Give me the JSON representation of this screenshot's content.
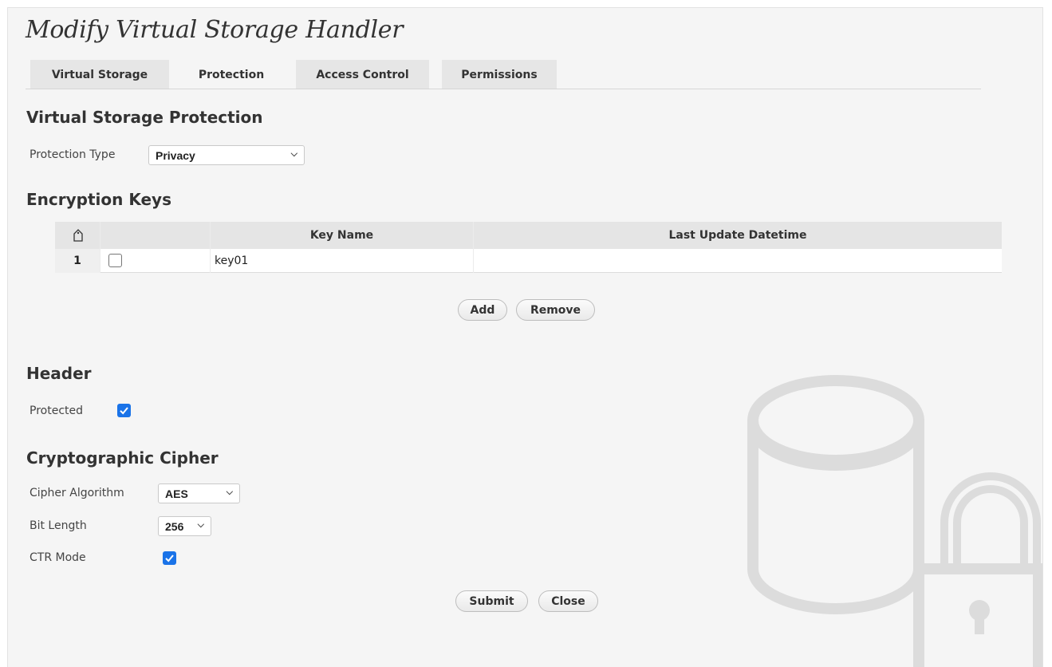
{
  "page": {
    "title": "Modify Virtual Storage Handler"
  },
  "tabs": [
    {
      "label": "Virtual Storage"
    },
    {
      "label": "Protection",
      "active": true
    },
    {
      "label": "Access Control"
    },
    {
      "label": "Permissions"
    }
  ],
  "protection": {
    "title": "Virtual Storage Protection",
    "type_label": "Protection Type",
    "type_value": "Privacy"
  },
  "keys": {
    "title": "Encryption Keys",
    "header_icon": "sort-tag-icon",
    "columns": [
      "Key Name",
      "Last Update Datetime"
    ],
    "rows": [
      {
        "num": "1",
        "checked": false,
        "key_name": "key01",
        "updated": ""
      }
    ],
    "add_label": "Add",
    "remove_label": "Remove"
  },
  "header": {
    "title": "Header",
    "protected_label": "Protected",
    "protected_checked": true
  },
  "cipher": {
    "title": "Cryptographic Cipher",
    "algorithm_label": "Cipher Algorithm",
    "algorithm_value": "AES",
    "bitlength_label": "Bit Length",
    "bitlength_value": "256",
    "ctr_label": "CTR Mode",
    "ctr_checked": true
  },
  "actions": {
    "submit_label": "Submit",
    "close_label": "Close"
  },
  "colors": {
    "accent": "#1a73e8",
    "panel_bg": "#f5f5f5",
    "watermark": "#dcdcdc"
  }
}
